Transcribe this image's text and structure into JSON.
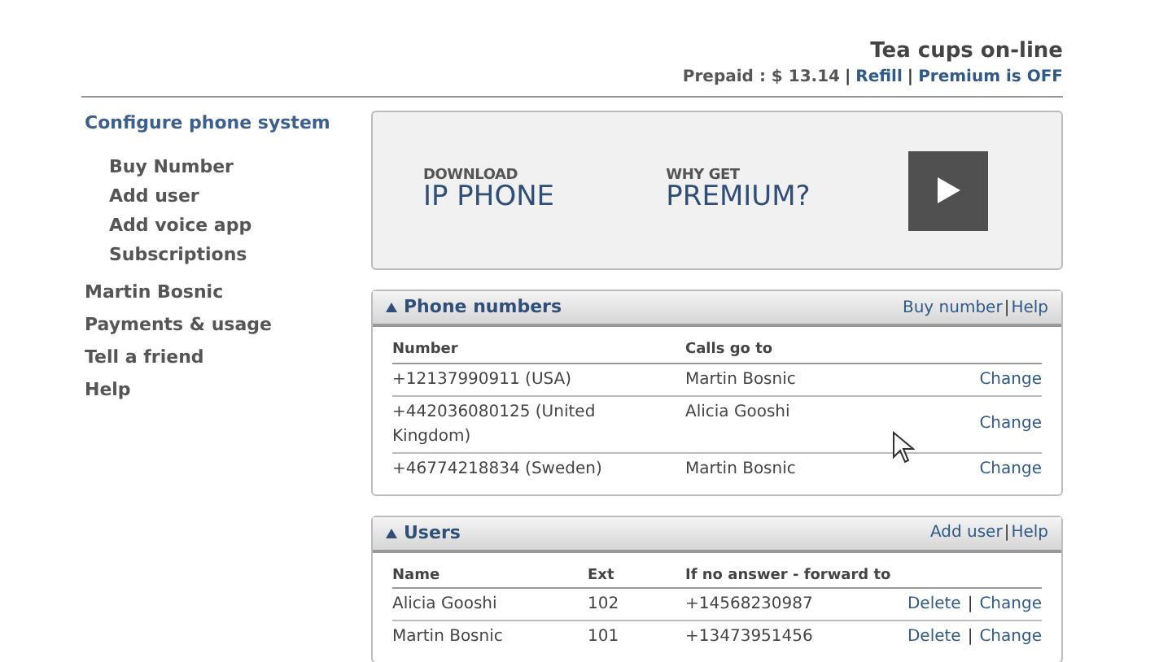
{
  "header": {
    "title": "Tea cups on-line",
    "items": [
      {
        "kind": "text",
        "text": "Prepaid : $ 13.14"
      },
      {
        "kind": "sep",
        "text": "|"
      },
      {
        "kind": "link",
        "text": "Refill"
      },
      {
        "kind": "sep",
        "text": "|"
      },
      {
        "kind": "link",
        "text": "Premium is OFF"
      }
    ]
  },
  "sidebar": {
    "items": [
      {
        "label": "Configure phone system",
        "selected": true,
        "children": [
          {
            "label": "Buy Number",
            "selected": false
          },
          {
            "label": "Add user",
            "selected": false
          },
          {
            "label": "Add voice app",
            "selected": false
          },
          {
            "label": "Subscriptions",
            "selected": false
          }
        ]
      },
      {
        "label": "Martin Bosnic",
        "selected": false
      },
      {
        "label": "Payments & usage",
        "selected": false
      },
      {
        "label": "Tell a friend",
        "selected": false
      },
      {
        "label": "Help",
        "selected": false
      }
    ]
  },
  "banner": {
    "promos": [
      {
        "small": "DOWNLOAD",
        "big": "IP PHONE"
      },
      {
        "small": "WHY GET",
        "big": "PREMIUM?"
      }
    ]
  },
  "panels": [
    {
      "title": "Phone numbers",
      "actions": [
        {
          "kind": "link",
          "text": "Buy number"
        },
        {
          "kind": "sep",
          "text": "|"
        },
        {
          "kind": "link",
          "text": "Help"
        }
      ],
      "columns": [
        "Number",
        "Calls go to"
      ],
      "rows": [
        {
          "cells": [
            "+12137990911 (USA)",
            "Martin Bosnic"
          ],
          "actions": [
            {
              "kind": "link",
              "text": "Change"
            }
          ]
        },
        {
          "cells": [
            "+442036080125 (United Kingdom)",
            "Alicia Gooshi"
          ],
          "actions": [
            {
              "kind": "link",
              "text": "Change"
            }
          ]
        },
        {
          "cells": [
            "+46774218834 (Sweden)",
            "Martin Bosnic"
          ],
          "actions": [
            {
              "kind": "link",
              "text": "Change"
            }
          ]
        }
      ]
    },
    {
      "title": "Users",
      "actions": [
        {
          "kind": "link",
          "text": "Add user"
        },
        {
          "kind": "sep",
          "text": "|"
        },
        {
          "kind": "link",
          "text": "Help"
        }
      ],
      "columns": [
        "Name",
        "Ext",
        "If no answer - forward to"
      ],
      "rows": [
        {
          "cells": [
            "Alicia Gooshi",
            "102",
            "+14568230987"
          ],
          "actions": [
            {
              "kind": "link",
              "text": "Delete"
            },
            {
              "kind": "sep",
              "text": "|"
            },
            {
              "kind": "link",
              "text": "Change"
            }
          ]
        },
        {
          "cells": [
            "Martin Bosnic",
            "101",
            "+13473951456"
          ],
          "actions": [
            {
              "kind": "link",
              "text": "Delete"
            },
            {
              "kind": "sep",
              "text": "|"
            },
            {
              "kind": "link",
              "text": "Change"
            }
          ]
        }
      ]
    }
  ]
}
